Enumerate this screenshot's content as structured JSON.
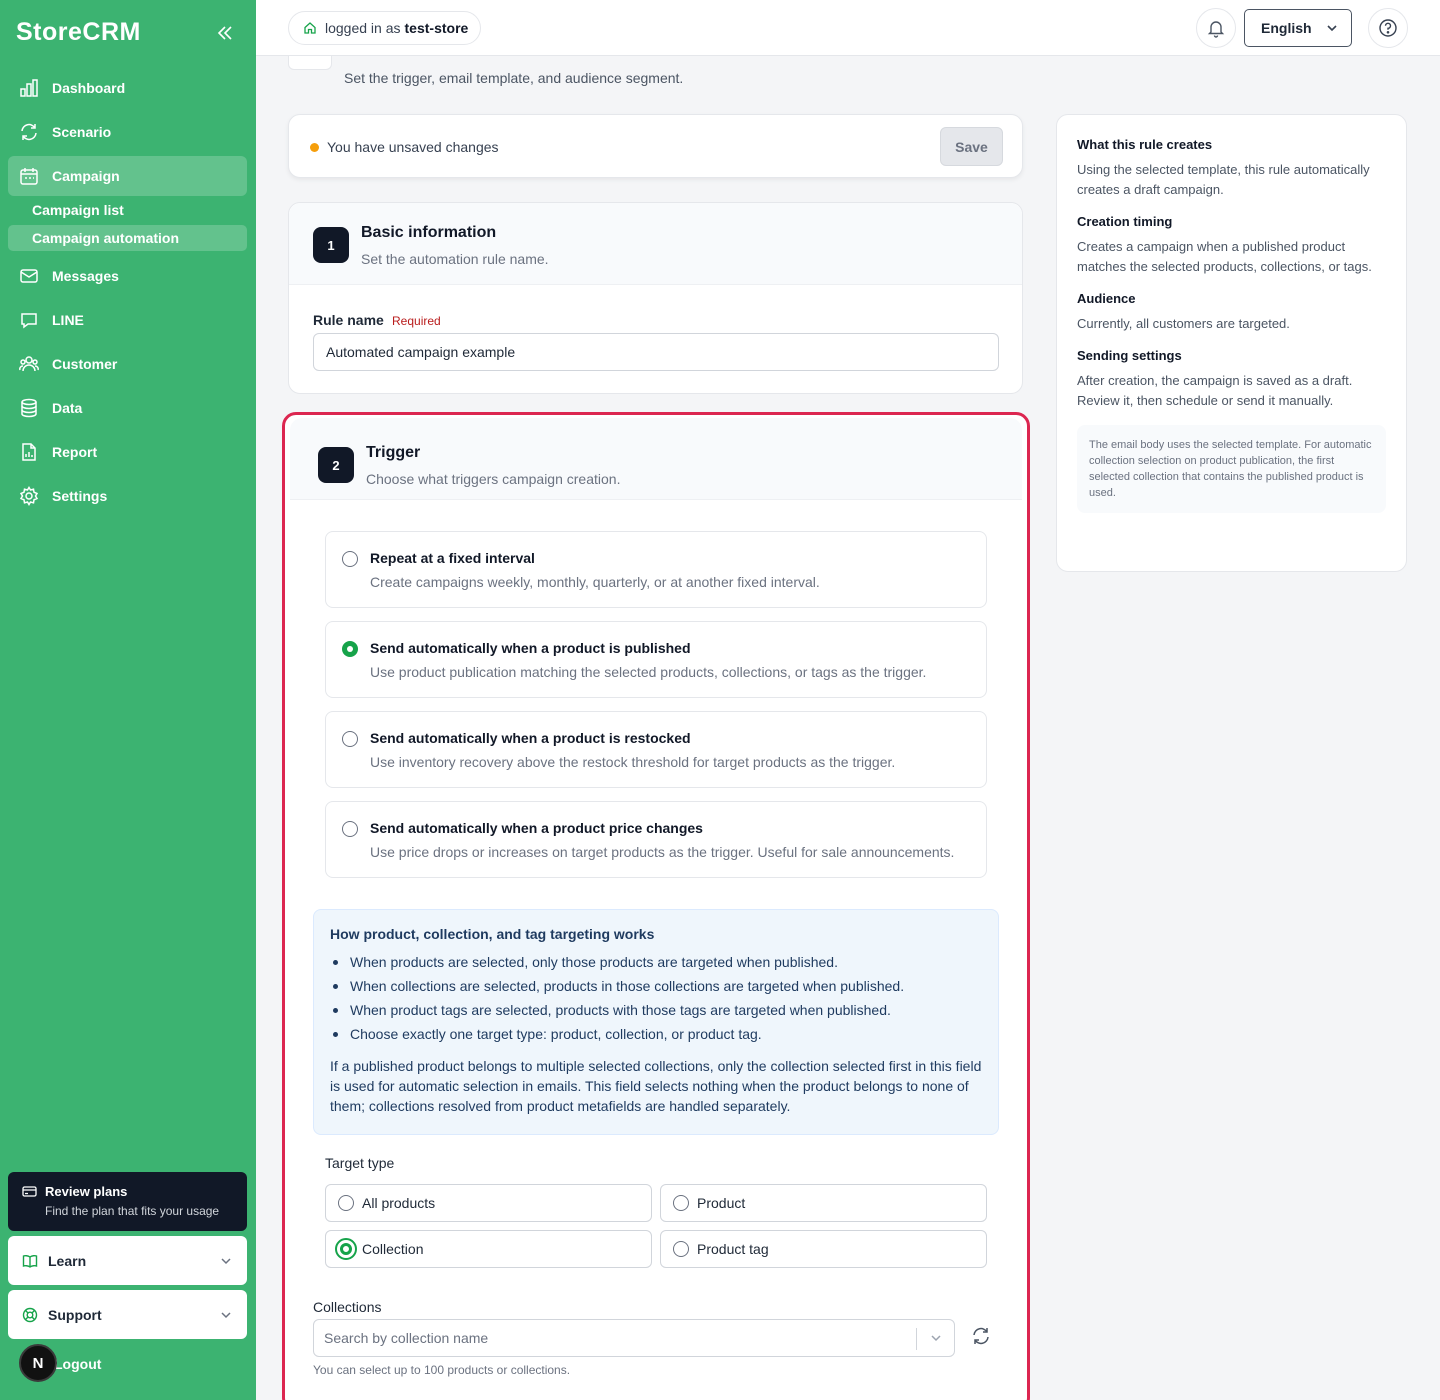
{
  "sidebar": {
    "brand": "StoreCRM",
    "items": [
      {
        "label": "Dashboard",
        "icon": "bar-chart-icon"
      },
      {
        "label": "Scenario",
        "icon": "refresh-icon"
      },
      {
        "label": "Campaign",
        "icon": "calendar-icon"
      },
      {
        "label": "Messages",
        "icon": "mail-icon"
      },
      {
        "label": "LINE",
        "icon": "chat-icon"
      },
      {
        "label": "Customer",
        "icon": "users-icon"
      },
      {
        "label": "Data",
        "icon": "database-icon"
      },
      {
        "label": "Report",
        "icon": "report-icon"
      },
      {
        "label": "Settings",
        "icon": "gear-icon"
      }
    ],
    "sub_items": [
      {
        "label": "Campaign list"
      },
      {
        "label": "Campaign automation"
      }
    ],
    "plans": {
      "title": "Review plans",
      "desc": "Find the plan that fits your usage"
    },
    "learn": "Learn",
    "support": "Support",
    "logout": "Logout",
    "avatar": "N"
  },
  "topbar": {
    "login_prefix": "logged in as",
    "store": "test-store",
    "language": "English"
  },
  "page": {
    "subtitle": "Set the trigger, email template, and audience segment."
  },
  "unsaved": {
    "text": "You have unsaved changes",
    "save": "Save"
  },
  "basic": {
    "step": "1",
    "title": "Basic information",
    "desc": "Set the automation rule name.",
    "rule_label": "Rule name",
    "required": "Required",
    "rule_value": "Automated campaign example"
  },
  "trigger": {
    "step": "2",
    "title": "Trigger",
    "desc": "Choose what triggers campaign creation.",
    "options": [
      {
        "title": "Repeat at a fixed interval",
        "desc": "Create campaigns weekly, monthly, quarterly, or at another fixed interval."
      },
      {
        "title": "Send automatically when a product is published",
        "desc": "Use product publication matching the selected products, collections, or tags as the trigger."
      },
      {
        "title": "Send automatically when a product is restocked",
        "desc": "Use inventory recovery above the restock threshold for target products as the trigger."
      },
      {
        "title": "Send automatically when a product price changes",
        "desc": "Use price drops or increases on target products as the trigger. Useful for sale announcements."
      }
    ],
    "info": {
      "title": "How product, collection, and tag targeting works",
      "bullets": [
        "When products are selected, only those products are targeted when published.",
        "When collections are selected, products in those collections are targeted when published.",
        "When product tags are selected, products with those tags are targeted when published.",
        "Choose exactly one target type: product, collection, or product tag."
      ],
      "para": "If a published product belongs to multiple selected collections, only the collection selected first in this field is used for automatic selection in emails. This field selects nothing when the product belongs to none of them; collections resolved from product metafields are handled separately."
    },
    "target_type_label": "Target type",
    "target_types": [
      "All products",
      "Product",
      "Collection",
      "Product tag"
    ],
    "collections_label": "Collections",
    "collections_placeholder": "Search by collection name",
    "hint": "You can select up to 100 products or collections."
  },
  "side": {
    "h1": "What this rule creates",
    "p1": "Using the selected template, this rule automatically creates a draft campaign.",
    "h2": "Creation timing",
    "p2": "Creates a campaign when a published product matches the selected products, collections, or tags.",
    "h3": "Audience",
    "p3": "Currently, all customers are targeted.",
    "h4": "Sending settings",
    "p4": "After creation, the campaign is saved as a draft. Review it, then schedule or send it manually.",
    "note": "The email body uses the selected template. For automatic collection selection on product publication, the first selected collection that contains the published product is used."
  },
  "colors": {
    "sidebar": "#3cb371",
    "accent": "#16a34a",
    "highlight": "#dc2650"
  }
}
